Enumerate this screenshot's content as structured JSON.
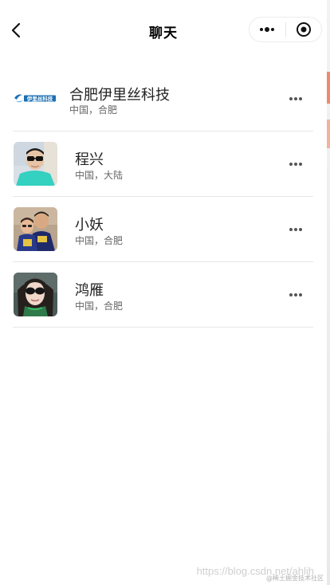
{
  "header": {
    "title": "聊天",
    "back_icon": "chevron-left-icon",
    "menu_icon": "more-dots-icon",
    "close_icon": "target-circle-icon"
  },
  "contacts": [
    {
      "name": "合肥伊里丝科技",
      "location": "中国，合肥",
      "avatar": "company-logo",
      "logo_text": "伊里丝科技"
    },
    {
      "name": "程兴",
      "location": "中国，大陆",
      "avatar": "man-with-sunglasses-photo"
    },
    {
      "name": "小妖",
      "location": "中国，合肥",
      "avatar": "couple-photo"
    },
    {
      "name": "鸿雁",
      "location": "中国，合肥",
      "avatar": "woman-with-sunglasses-photo"
    }
  ],
  "watermark": {
    "url": "https://blog.csdn.net/ahlih",
    "tag": "@稀土掘金技术社区"
  },
  "colors": {
    "background": "#ffffff",
    "divider": "#e6e6e6",
    "logo_blue": "#1a6fb5"
  }
}
